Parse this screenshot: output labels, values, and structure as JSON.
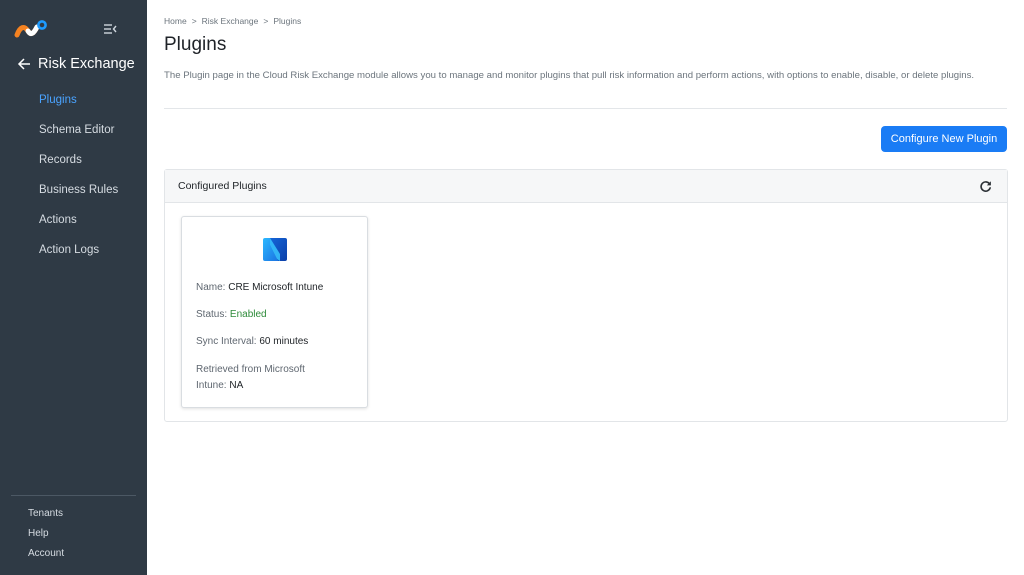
{
  "sidebar": {
    "back_label": "Risk Exchange",
    "items": [
      {
        "label": "Plugins",
        "active": true
      },
      {
        "label": "Schema Editor"
      },
      {
        "label": "Records"
      },
      {
        "label": "Business Rules"
      },
      {
        "label": "Actions"
      },
      {
        "label": "Action Logs"
      }
    ],
    "footer": [
      "Tenants",
      "Help",
      "Account"
    ]
  },
  "breadcrumb": [
    "Home",
    "Risk Exchange",
    "Plugins"
  ],
  "breadcrumb_separator": ">",
  "page": {
    "title": "Plugins",
    "description": "The Plugin page in the Cloud Risk Exchange module allows you to manage and monitor plugins that pull risk information and perform actions, with options to enable, disable, or delete plugins.",
    "configure_button": "Configure New Plugin"
  },
  "configured": {
    "title": "Configured Plugins",
    "plugins": [
      {
        "name_label": "Name:",
        "name": "CRE Microsoft Intune",
        "status_label": "Status:",
        "status": "Enabled",
        "sync_label": "Sync Interval:",
        "sync": "60 minutes",
        "retrieved_label": "Retrieved from Microsoft Intune:",
        "retrieved": "NA"
      }
    ]
  },
  "colors": {
    "sidebar_bg": "#2f3a45",
    "accent": "#1a7cf5",
    "active_nav": "#4aa3ff",
    "status_enabled": "#2e8b3a"
  },
  "icons": [
    "netskope-logo",
    "collapse-sidebar-icon",
    "back-arrow-icon",
    "refresh-icon",
    "intune-plugin-logo"
  ]
}
